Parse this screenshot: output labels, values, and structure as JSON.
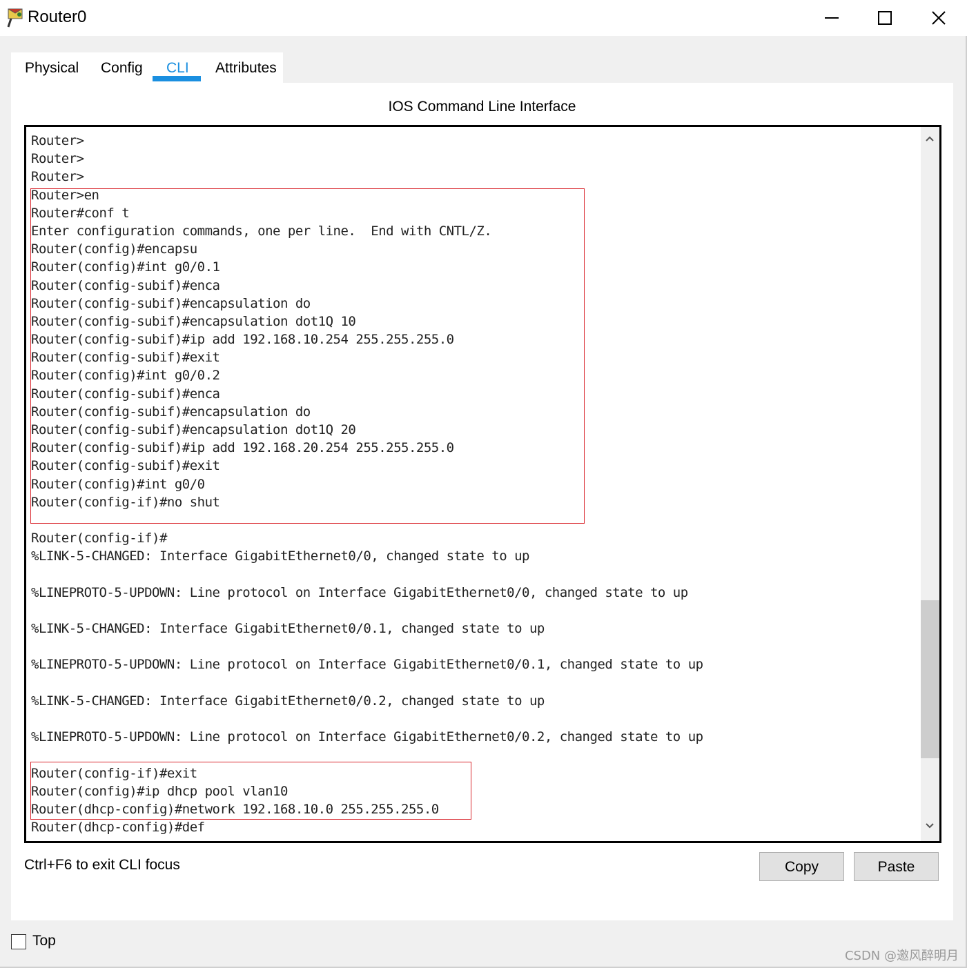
{
  "window": {
    "title": "Router0",
    "icon": "router-icon"
  },
  "tabs": [
    {
      "label": "Physical",
      "active": false
    },
    {
      "label": "Config",
      "active": false
    },
    {
      "label": "CLI",
      "active": true
    },
    {
      "label": "Attributes",
      "active": false
    }
  ],
  "cli": {
    "heading": "IOS Command Line Interface",
    "lines": [
      "Router>",
      "Router>",
      "Router>",
      "Router>en",
      "Router#conf t",
      "Enter configuration commands, one per line.  End with CNTL/Z.",
      "Router(config)#encapsu",
      "Router(config)#int g0/0.1",
      "Router(config-subif)#enca",
      "Router(config-subif)#encapsulation do",
      "Router(config-subif)#encapsulation dot1Q 10",
      "Router(config-subif)#ip add 192.168.10.254 255.255.255.0",
      "Router(config-subif)#exit",
      "Router(config)#int g0/0.2",
      "Router(config-subif)#enca",
      "Router(config-subif)#encapsulation do",
      "Router(config-subif)#encapsulation dot1Q 20",
      "Router(config-subif)#ip add 192.168.20.254 255.255.255.0",
      "Router(config-subif)#exit",
      "Router(config)#int g0/0",
      "Router(config-if)#no shut",
      "",
      "Router(config-if)#",
      "%LINK-5-CHANGED: Interface GigabitEthernet0/0, changed state to up",
      "",
      "%LINEPROTO-5-UPDOWN: Line protocol on Interface GigabitEthernet0/0, changed state to up",
      "",
      "%LINK-5-CHANGED: Interface GigabitEthernet0/0.1, changed state to up",
      "",
      "%LINEPROTO-5-UPDOWN: Line protocol on Interface GigabitEthernet0/0.1, changed state to up",
      "",
      "%LINK-5-CHANGED: Interface GigabitEthernet0/0.2, changed state to up",
      "",
      "%LINEPROTO-5-UPDOWN: Line protocol on Interface GigabitEthernet0/0.2, changed state to up",
      "",
      "Router(config-if)#exit",
      "Router(config)#ip dhcp pool vlan10",
      "Router(dhcp-config)#network 192.168.10.0 255.255.255.0",
      "Router(dhcp-config)#def"
    ],
    "highlight_color": "#d9272e"
  },
  "footer": {
    "hint": "Ctrl+F6 to exit CLI focus",
    "copy_label": "Copy",
    "paste_label": "Paste",
    "top_label": "Top",
    "top_checked": false
  },
  "watermark": "CSDN @邀风醉明月",
  "colors": {
    "accent": "#1a8fe0"
  }
}
